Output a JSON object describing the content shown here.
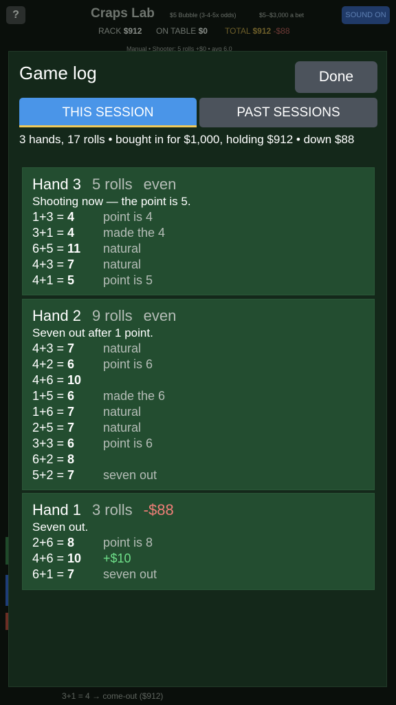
{
  "background": {
    "help_label": "?",
    "title": "Craps Lab",
    "table_info": "$5 Bubble (3-4-5x odds)",
    "bet_range": "$5–$3,000 a bet",
    "sound_label": "SOUND ON",
    "rack_label": "RACK",
    "rack_value": "$912",
    "on_table_label": "ON TABLE",
    "on_table_value": "$0",
    "total_label": "TOTAL",
    "total_value": "$912",
    "total_delta": "-$88",
    "mode_line": "Manual  •  Shooter: 5 rolls  +$0  •  avg 6.0",
    "bottom_line": "3+1 = 4  →  come-out  ($912)"
  },
  "modal": {
    "title": "Game log",
    "done_label": "Done",
    "tabs": [
      {
        "label": "THIS SESSION",
        "active": true
      },
      {
        "label": "PAST SESSIONS",
        "active": false
      }
    ],
    "summary": "3 hands, 17 rolls  •  bought in for $1,000, holding $912  •  down $88",
    "hands": [
      {
        "title": "Hand 3",
        "rolls_label": "5 rolls",
        "result": "even",
        "description": "Shooting now — the point is 5.",
        "rolls": [
          {
            "dice": "1+3 = ",
            "total": "4",
            "note": "point is 4"
          },
          {
            "dice": "3+1 = ",
            "total": "4",
            "note": "made the 4"
          },
          {
            "dice": "6+5 = ",
            "total": "11",
            "note": "natural"
          },
          {
            "dice": "4+3 = ",
            "total": "7",
            "note": "natural"
          },
          {
            "dice": "4+1 = ",
            "total": "5",
            "note": "point is 5"
          }
        ]
      },
      {
        "title": "Hand 2",
        "rolls_label": "9 rolls",
        "result": "even",
        "description": "Seven out after 1 point.",
        "rolls": [
          {
            "dice": "4+3 = ",
            "total": "7",
            "note": "natural"
          },
          {
            "dice": "4+2 = ",
            "total": "6",
            "note": "point is 6"
          },
          {
            "dice": "4+6 = ",
            "total": "10",
            "note": ""
          },
          {
            "dice": "1+5 = ",
            "total": "6",
            "note": "made the 6"
          },
          {
            "dice": "1+6 = ",
            "total": "7",
            "note": "natural"
          },
          {
            "dice": "2+5 = ",
            "total": "7",
            "note": "natural"
          },
          {
            "dice": "3+3 = ",
            "total": "6",
            "note": "point is 6"
          },
          {
            "dice": "6+2 = ",
            "total": "8",
            "note": ""
          },
          {
            "dice": "5+2 = ",
            "total": "7",
            "note": "seven out"
          }
        ]
      },
      {
        "title": "Hand 1",
        "rolls_label": "3 rolls",
        "result": "-$88",
        "description": "Seven out.",
        "rolls": [
          {
            "dice": "2+6 = ",
            "total": "8",
            "note": "point is 8"
          },
          {
            "dice": "4+6 = ",
            "total": "10",
            "note": "+$10"
          },
          {
            "dice": "6+1 = ",
            "total": "7",
            "note": "seven out"
          }
        ]
      }
    ]
  },
  "colors": {
    "modal_bg": "#14281a",
    "hand_bg": "#234d30",
    "tab_active": "#4a95e8",
    "tab_underline": "#f0c95a",
    "button_gray": "#4c535c",
    "loss_red": "#f07f78",
    "win_green": "#6fe08a"
  }
}
